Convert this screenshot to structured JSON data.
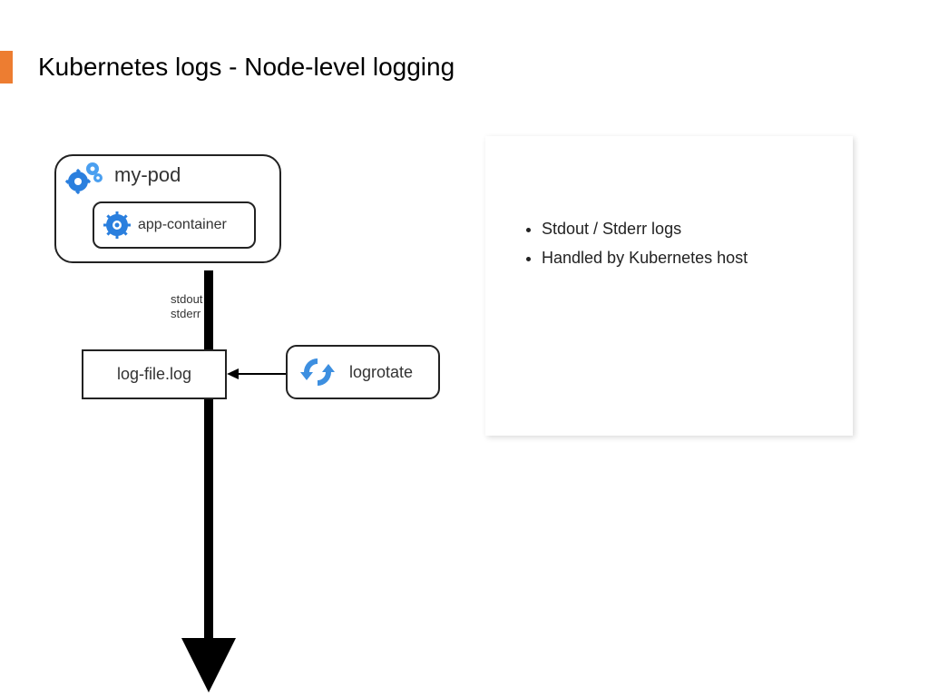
{
  "slide": {
    "title": "Kubernetes logs  - Node-level logging",
    "accent_color": "#ed7d31"
  },
  "diagram": {
    "pod": {
      "label": "my-pod",
      "icon": "gears-icon"
    },
    "container": {
      "label": "app-container",
      "icon": "gear-icon"
    },
    "arrow1_label_line1": "stdout",
    "arrow1_label_line2": "stderr",
    "logfile": {
      "label": "log-file.log"
    },
    "logrotate": {
      "label": "logrotate",
      "icon": "cycle-icon"
    }
  },
  "panel": {
    "bullets": [
      "Stdout / Stderr logs",
      "Handled by Kubernetes host"
    ]
  }
}
